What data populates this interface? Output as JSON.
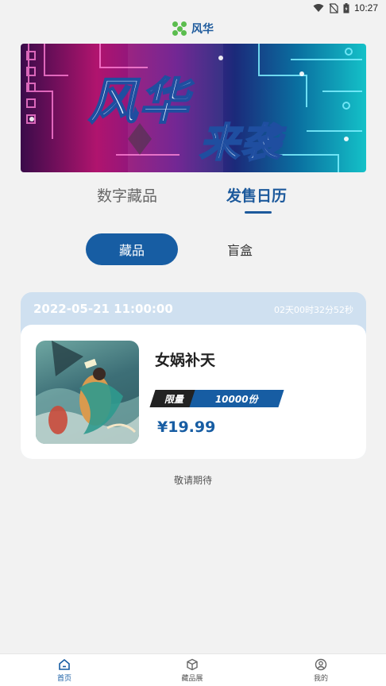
{
  "status_bar": {
    "time": "10:27"
  },
  "header": {
    "app_name": "风华"
  },
  "banner": {
    "line1": "风华",
    "line2": "来袭"
  },
  "main_tabs": [
    {
      "label": "数字藏品",
      "active": false
    },
    {
      "label": "发售日历",
      "active": true
    }
  ],
  "sub_tabs": [
    {
      "label": "藏品",
      "active": true
    },
    {
      "label": "盲盒",
      "active": false
    }
  ],
  "card": {
    "datetime": "2022-05-21 11:00:00",
    "countdown": "02天00时32分52秒",
    "name": "女娲补天",
    "limit_label": "限量",
    "quantity": "10000份",
    "price": "¥19.99"
  },
  "footer_note": "敬请期待",
  "bottom_nav": [
    {
      "label": "首页",
      "icon": "home-icon",
      "active": true
    },
    {
      "label": "藏品展",
      "icon": "cube-icon",
      "active": false
    },
    {
      "label": "我的",
      "icon": "user-icon",
      "active": false
    }
  ],
  "colors": {
    "accent": "#175da3",
    "logo_green": "#5bbd4e",
    "card_header": "#cfe0f0"
  }
}
